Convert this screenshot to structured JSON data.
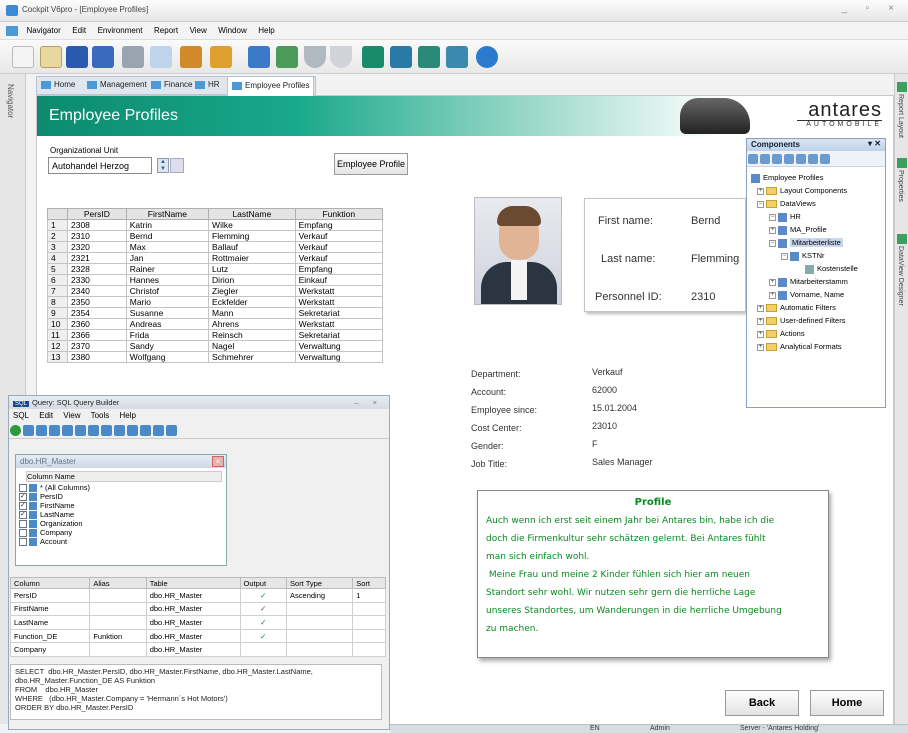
{
  "window": {
    "title": "Cockpit V6pro - [Employee Profiles]"
  },
  "menu": [
    "Navigator",
    "Edit",
    "Environment",
    "Report",
    "View",
    "Window",
    "Help"
  ],
  "navigator_label": "Navigator",
  "tabs": [
    "Home",
    "Management",
    "Finance",
    "HR",
    "Employee Profiles"
  ],
  "banner": {
    "title": "Employee Profiles",
    "brand": "antares",
    "brand_sub": "AUTOMOBILE"
  },
  "org": {
    "label": "Organizational Unit",
    "value": "Autohandel Herzog",
    "button": "Employee Profile"
  },
  "employees": {
    "headers": [
      "",
      "PersID",
      "FirstName",
      "LastName",
      "Funktion"
    ],
    "rows": [
      [
        "1",
        "2308",
        "Katrin",
        "Wilke",
        "Empfang"
      ],
      [
        "2",
        "2310",
        "Bernd",
        "Flemming",
        "Verkauf"
      ],
      [
        "3",
        "2320",
        "Max",
        "Ballauf",
        "Verkauf"
      ],
      [
        "4",
        "2321",
        "Jan",
        "Rottmaier",
        "Verkauf"
      ],
      [
        "5",
        "2328",
        "Rainer",
        "Lutz",
        "Empfang"
      ],
      [
        "6",
        "2330",
        "Hannes",
        "Dirion",
        "Einkauf"
      ],
      [
        "7",
        "2340",
        "Christof",
        "Ziegler",
        "Werkstatt"
      ],
      [
        "8",
        "2350",
        "Mario",
        "Eckfelder",
        "Werkstatt"
      ],
      [
        "9",
        "2354",
        "Susanne",
        "Mann",
        "Sekretariat"
      ],
      [
        "10",
        "2360",
        "Andreas",
        "Ahrens",
        "Werkstatt"
      ],
      [
        "11",
        "2366",
        "Frida",
        "Reinsch",
        "Sekretariat"
      ],
      [
        "12",
        "2370",
        "Sandy",
        "Nagel",
        "Verwaltung"
      ],
      [
        "13",
        "2380",
        "Wolfgang",
        "Schmehrer",
        "Verwaltung"
      ]
    ]
  },
  "person": {
    "first_label": "First name:",
    "first": "Bernd",
    "last_label": "Last name:",
    "last": "Flemming",
    "id_label": "Personnel ID:",
    "id": "2310"
  },
  "details": [
    {
      "label": "Department:",
      "value": "Verkauf"
    },
    {
      "label": "Account:",
      "value": "62000"
    },
    {
      "label": "Employee since:",
      "value": "15.01.2004"
    },
    {
      "label": "Cost Center:",
      "value": "23010"
    },
    {
      "label": "Gender:",
      "value": "F"
    },
    {
      "label": "Job Title:",
      "value": "Sales Manager"
    }
  ],
  "profile": {
    "title": "Profile",
    "text": "Auch wenn ich erst seit einem Jahr bei Antares bin, habe ich die\ndoch die Firmenkultur sehr schätzen gelernt. Bei Antares fühlt\nman sich einfach wohl.\n Meine Frau und meine 2 Kinder fühlen sich hier am neuen\nStandort sehr wohl. Wir nutzen sehr gern die herrliche Lage\nunseres Standortes, um Wanderungen in die herrliche Umgebung\nzu machen."
  },
  "buttons": {
    "back": "Back",
    "home": "Home"
  },
  "components": {
    "title": "Components",
    "tree": [
      "Employee Profiles",
      "Layout Components",
      "DataViews",
      "HR",
      "MA_Profile",
      "Mitarbeiterliste",
      "KSTNr",
      "Kostenstelle",
      "Mitarbeiterstamm",
      "Vorname, Name",
      "Automatic Filters",
      "User-defined Filters",
      "Actions",
      "Analytical Formats"
    ]
  },
  "right_strip": [
    "Report Layout",
    "Properties",
    "DataView Designer"
  ],
  "sql": {
    "title": "Query: SQL Query Builder",
    "menu": [
      "SQL",
      "Edit",
      "View",
      "Tools",
      "Help"
    ],
    "table_name": "dbo.HR_Master",
    "column_header": "Column Name",
    "columns": [
      {
        "name": "* (All Columns)",
        "checked": false
      },
      {
        "name": "PersID",
        "checked": true
      },
      {
        "name": "FirstName",
        "checked": true
      },
      {
        "name": "LastName",
        "checked": true
      },
      {
        "name": "Organization",
        "checked": false
      },
      {
        "name": "Company",
        "checked": false
      },
      {
        "name": "Account",
        "checked": false
      }
    ],
    "grid_headers": [
      "Column",
      "Alias",
      "Table",
      "Output",
      "Sort Type",
      "Sort"
    ],
    "grid_rows": [
      [
        "PersID",
        "",
        "dbo.HR_Master",
        "✓",
        "Ascending",
        "1"
      ],
      [
        "FirstName",
        "",
        "dbo.HR_Master",
        "✓",
        "",
        ""
      ],
      [
        "LastName",
        "",
        "dbo.HR_Master",
        "✓",
        "",
        ""
      ],
      [
        "Function_DE",
        "Funktion",
        "dbo.HR_Master",
        "✓",
        "",
        ""
      ],
      [
        "Company",
        "",
        "dbo.HR_Master",
        "",
        "",
        ""
      ]
    ],
    "query": "SELECT  dbo.HR_Master.PersID, dbo.HR_Master.FirstName, dbo.HR_Master.LastName,\ndbo.HR_Master.Function_DE AS Funktion\nFROM    dbo.HR_Master\nWHERE   (dbo.HR_Master.Company = 'Hermann´s Hot Motors')\nORDER BY dbo.HR_Master.PersID"
  },
  "status": {
    "lang": "EN",
    "user": "Admin",
    "server": "Server - 'Antares Holding'"
  }
}
